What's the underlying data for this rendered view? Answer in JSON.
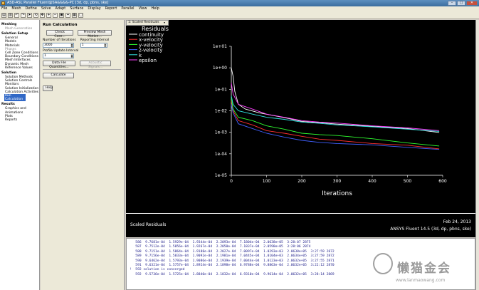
{
  "window": {
    "title": "ASD-ASL Parallel Fluent@SA&&&&-PC  [3d, dp, pbns, ske]"
  },
  "menubar": [
    "File",
    "Mesh",
    "Define",
    "Solve",
    "Adapt",
    "Surface",
    "Display",
    "Report",
    "Parallel",
    "View",
    "Help"
  ],
  "toolbar": {
    "icon_names": [
      "open-icon",
      "save-icon",
      "undo-icon",
      "redo-icon",
      "pointer-icon",
      "rotate-icon",
      "pan-icon",
      "zoom-in-icon",
      "zoom-out-icon",
      "fit-icon",
      "probe-icon",
      "colormap-icon",
      "window-icon"
    ],
    "view_select": ""
  },
  "tree": [
    {
      "type": "sec",
      "label": "Meshing"
    },
    {
      "type": "item",
      "label": "Mesh Generation",
      "dim": true
    },
    {
      "type": "sec",
      "label": "Solution Setup"
    },
    {
      "type": "item",
      "label": "General"
    },
    {
      "type": "item",
      "label": "Models"
    },
    {
      "type": "item",
      "label": "Materials"
    },
    {
      "type": "item",
      "label": "Phases",
      "dim": true
    },
    {
      "type": "item",
      "label": "Cell Zone Conditions"
    },
    {
      "type": "item",
      "label": "Boundary Conditions"
    },
    {
      "type": "item",
      "label": "Mesh Interfaces"
    },
    {
      "type": "item",
      "label": "Dynamic Mesh"
    },
    {
      "type": "item",
      "label": "Reference Values"
    },
    {
      "type": "sec",
      "label": "Solution"
    },
    {
      "type": "item",
      "label": "Solution Methods"
    },
    {
      "type": "item",
      "label": "Solution Controls"
    },
    {
      "type": "item",
      "label": "Monitors"
    },
    {
      "type": "item",
      "label": "Solution Initialization"
    },
    {
      "type": "item",
      "label": "Calculation Activities"
    },
    {
      "type": "item",
      "label": "Run Calculation",
      "active": true
    },
    {
      "type": "sec",
      "label": "Results"
    },
    {
      "type": "item",
      "label": "Graphics and Animations"
    },
    {
      "type": "item",
      "label": "Plots"
    },
    {
      "type": "item",
      "label": "Reports"
    }
  ],
  "task": {
    "title": "Run Calculation",
    "check_case": "Check Case...",
    "preview_mesh": "Preview Mesh Motion...",
    "iterations_label": "Number of Iterations",
    "iterations_value": "3000",
    "reporting_label": "Reporting Interval",
    "reporting_value": "1",
    "profile_label": "Profile Update Interval",
    "profile_value": "1",
    "data_file": "Data File Quantities...",
    "acoustic": "Acoustic Signals...",
    "calculate": "Calculate",
    "help": "Help"
  },
  "graphics": {
    "tab_label": "1: Scaled Residuals",
    "caption": "Scaled Residuals",
    "date": "Feb 24, 2013",
    "version": "ANSYS Fluent 14.5 (3d, dp, pbns, ske)"
  },
  "chart_data": {
    "type": "line",
    "title": "",
    "xlabel": "Iterations",
    "ylabel": "",
    "yscale": "log",
    "xlim": [
      0,
      600
    ],
    "ylim": [
      1e-05,
      10
    ],
    "xticks": [
      "0",
      "100",
      "200",
      "300",
      "400",
      "500",
      "600"
    ],
    "yticks": [
      "1e+01",
      "1e+00",
      "1e-01",
      "1e-02",
      "1e-03",
      "1e-04",
      "1e-05"
    ],
    "legend_title": "Residuals",
    "legend_position": "top-left",
    "series": [
      {
        "name": "continuity",
        "color": "#ffffff",
        "points": [
          [
            0,
            1
          ],
          [
            5,
            0.4
          ],
          [
            10,
            0.08
          ],
          [
            20,
            0.02
          ],
          [
            40,
            0.012
          ],
          [
            80,
            0.008
          ],
          [
            120,
            0.006
          ],
          [
            160,
            0.0045
          ],
          [
            200,
            0.0032
          ],
          [
            250,
            0.0028
          ],
          [
            300,
            0.0024
          ],
          [
            400,
            0.0019
          ],
          [
            500,
            0.0015
          ],
          [
            590,
            0.00098
          ]
        ]
      },
      {
        "name": "x-velocity",
        "color": "#ff3030",
        "points": [
          [
            0,
            0.03
          ],
          [
            5,
            0.01
          ],
          [
            20,
            0.0035
          ],
          [
            60,
            0.0022
          ],
          [
            100,
            0.0012
          ],
          [
            150,
            0.0009
          ],
          [
            200,
            0.00065
          ],
          [
            250,
            0.00048
          ],
          [
            300,
            0.00042
          ],
          [
            400,
            0.0003
          ],
          [
            500,
            0.00025
          ],
          [
            590,
            0.00017
          ]
        ]
      },
      {
        "name": "y-velocity",
        "color": "#30ff30",
        "points": [
          [
            0,
            0.04
          ],
          [
            5,
            0.012
          ],
          [
            20,
            0.005
          ],
          [
            60,
            0.0035
          ],
          [
            100,
            0.002
          ],
          [
            150,
            0.0014
          ],
          [
            200,
            0.0009
          ],
          [
            250,
            0.00078
          ],
          [
            300,
            0.00071
          ],
          [
            400,
            0.0005
          ],
          [
            500,
            0.00032
          ],
          [
            590,
            0.00023
          ]
        ]
      },
      {
        "name": "z-velocity",
        "color": "#4060ff",
        "points": [
          [
            0,
            0.02
          ],
          [
            5,
            0.008
          ],
          [
            20,
            0.0025
          ],
          [
            60,
            0.0015
          ],
          [
            100,
            0.0009
          ],
          [
            150,
            0.0006
          ],
          [
            200,
            0.00042
          ],
          [
            250,
            0.00034
          ],
          [
            300,
            0.0003
          ],
          [
            400,
            0.00026
          ],
          [
            500,
            0.0002
          ],
          [
            590,
            0.00016
          ]
        ]
      },
      {
        "name": "k",
        "color": "#30e0e0",
        "points": [
          [
            0,
            0.05
          ],
          [
            5,
            0.02
          ],
          [
            20,
            0.01
          ],
          [
            60,
            0.007
          ],
          [
            100,
            0.005
          ],
          [
            150,
            0.004
          ],
          [
            200,
            0.003
          ],
          [
            250,
            0.0026
          ],
          [
            300,
            0.0022
          ],
          [
            400,
            0.0018
          ],
          [
            500,
            0.0014
          ],
          [
            590,
            0.0011
          ]
        ]
      },
      {
        "name": "epsilon",
        "color": "#ff40ff",
        "points": [
          [
            0,
            0.2
          ],
          [
            5,
            0.06
          ],
          [
            20,
            0.02
          ],
          [
            60,
            0.012
          ],
          [
            100,
            0.007
          ],
          [
            150,
            0.005
          ],
          [
            200,
            0.0035
          ],
          [
            250,
            0.003
          ],
          [
            300,
            0.0027
          ],
          [
            400,
            0.002
          ],
          [
            500,
            0.0016
          ],
          [
            590,
            0.0012
          ]
        ]
      }
    ]
  },
  "console": [
    "   586  9.7681e-04  1.5929e-04  1.9344e-04  2.2093e-04  7.1804e-04  2.0638e+05  3:28:07 2875",
    "   587  9.7512e-04  1.5856e-04  1.9267e-04  2.2050e-04  7.1837e-04  2.0598e+05  3:28:06 2874",
    "   588  9.7151e-04  1.5864e-04  1.9188e-04  2.2027e-04  7.0097e-04  1.0293e+03  2.0638e+05  3:27:59 2872",
    "   589  9.7156e-04  1.5833e-04  1.9092e-04  2.1981e-04  7.0445e-04  1.0104e+03  2.0634e+05  3:27:59 2872",
    "   590  9.6462e-04  1.5793e-04  1.9086e-04  2.1939e-04  7.0044e-04  1.0123e+03  2.0632e+05  3:27:55 2871",
    "   591  9.6321e-04  1.5757e-04  1.8924e-04  2.1898e-04  6.9788e-04  9.8863e-04  2.0632e+05  3:22:12 2870",
    "!  592 solution is converged",
    "   592  9.5736e-04  1.5725e-04  1.8840e-04  2.1832e-04  6.9310e-04  9.9614e-04  2.0632e+05  3:28:14 2869"
  ],
  "watermark": {
    "text": "懒猫金会",
    "url": "www.lanmaowang.com"
  }
}
